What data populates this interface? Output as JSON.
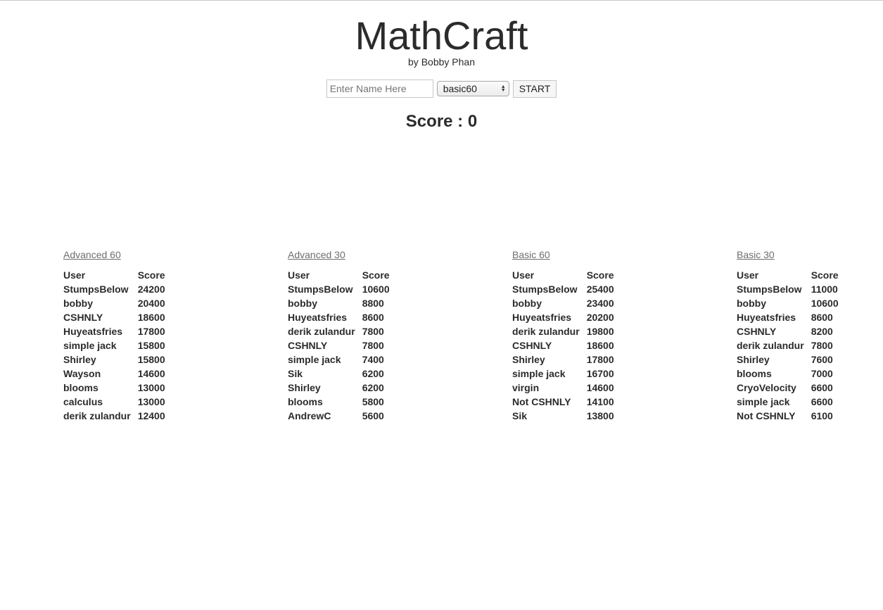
{
  "header": {
    "title": "MathCraft",
    "subtitle": "by Bobby Phan"
  },
  "controls": {
    "name_placeholder": "Enter Name Here",
    "name_value": "",
    "mode_selected": "basic60",
    "start_label": "START"
  },
  "score": {
    "label": "Score : 0"
  },
  "leaderboards": [
    {
      "title": "Advanced 60",
      "col_user": "User",
      "col_score": "Score",
      "rows": [
        {
          "user": "StumpsBelow",
          "score": "24200"
        },
        {
          "user": "bobby",
          "score": "20400"
        },
        {
          "user": "CSHNLY",
          "score": "18600"
        },
        {
          "user": "Huyeatsfries",
          "score": "17800"
        },
        {
          "user": "simple jack",
          "score": "15800"
        },
        {
          "user": "Shirley",
          "score": "15800"
        },
        {
          "user": "Wayson",
          "score": "14600"
        },
        {
          "user": "blooms",
          "score": "13000"
        },
        {
          "user": "calculus",
          "score": "13000"
        },
        {
          "user": "derik zulandur",
          "score": "12400"
        }
      ]
    },
    {
      "title": "Advanced 30",
      "col_user": "User",
      "col_score": "Score",
      "rows": [
        {
          "user": "StumpsBelow",
          "score": "10600"
        },
        {
          "user": "bobby",
          "score": "8800"
        },
        {
          "user": "Huyeatsfries",
          "score": "8600"
        },
        {
          "user": "derik zulandur",
          "score": "7800"
        },
        {
          "user": "CSHNLY",
          "score": "7800"
        },
        {
          "user": "simple jack",
          "score": "7400"
        },
        {
          "user": "Sik",
          "score": "6200"
        },
        {
          "user": "Shirley",
          "score": "6200"
        },
        {
          "user": "blooms",
          "score": "5800"
        },
        {
          "user": "AndrewC",
          "score": "5600"
        }
      ]
    },
    {
      "title": "Basic 60",
      "col_user": "User",
      "col_score": "Score",
      "rows": [
        {
          "user": "StumpsBelow",
          "score": "25400"
        },
        {
          "user": "bobby",
          "score": "23400"
        },
        {
          "user": "Huyeatsfries",
          "score": "20200"
        },
        {
          "user": "derik zulandur",
          "score": "19800"
        },
        {
          "user": "CSHNLY",
          "score": "18600"
        },
        {
          "user": "Shirley",
          "score": "17800"
        },
        {
          "user": "simple jack",
          "score": "16700"
        },
        {
          "user": "virgin",
          "score": "14600"
        },
        {
          "user": "Not CSHNLY",
          "score": "14100"
        },
        {
          "user": "Sik",
          "score": "13800"
        }
      ]
    },
    {
      "title": "Basic 30",
      "col_user": "User",
      "col_score": "Score",
      "rows": [
        {
          "user": "StumpsBelow",
          "score": "11000"
        },
        {
          "user": "bobby",
          "score": "10600"
        },
        {
          "user": "Huyeatsfries",
          "score": "8600"
        },
        {
          "user": "CSHNLY",
          "score": "8200"
        },
        {
          "user": "derik zulandur",
          "score": "7800"
        },
        {
          "user": "Shirley",
          "score": "7600"
        },
        {
          "user": "blooms",
          "score": "7000"
        },
        {
          "user": "CryoVelocity",
          "score": "6600"
        },
        {
          "user": "simple jack",
          "score": "6600"
        },
        {
          "user": "Not CSHNLY",
          "score": "6100"
        }
      ]
    }
  ]
}
